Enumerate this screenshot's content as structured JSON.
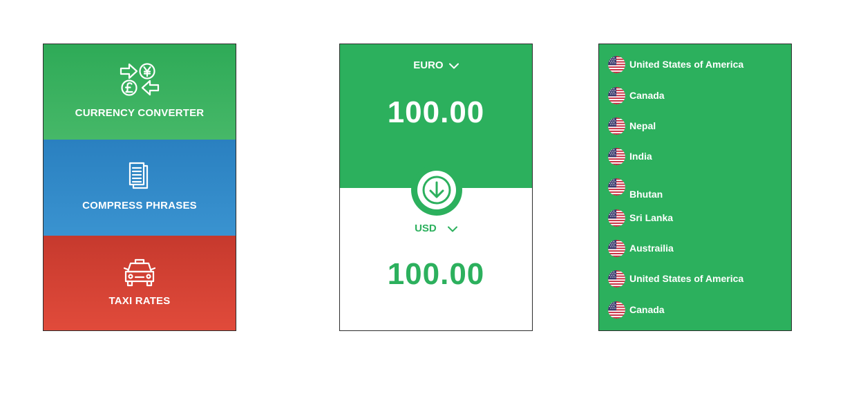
{
  "menu": {
    "items": [
      {
        "label": "CURRENCY CONVERTER",
        "icon": "currency-exchange-icon",
        "color": "#2eaa57"
      },
      {
        "label": "COMPRESS PHRASES",
        "icon": "document-icon",
        "color": "#2a80c0"
      },
      {
        "label": "TAXI RATES",
        "icon": "taxi-icon",
        "color": "#d44233"
      }
    ]
  },
  "converter": {
    "from_currency": "EURO",
    "from_amount": "100.00",
    "to_currency": "USD",
    "to_amount": "100.00",
    "accent": "#2cb05d"
  },
  "countries": [
    {
      "name": "United States of America",
      "flag": "us-flag-icon"
    },
    {
      "name": "Canada",
      "flag": "us-flag-icon"
    },
    {
      "name": "Nepal",
      "flag": "us-flag-icon"
    },
    {
      "name": "India",
      "flag": "us-flag-icon"
    },
    {
      "name": "Bhutan",
      "flag": "us-flag-icon"
    },
    {
      "name": "Sri Lanka",
      "flag": "us-flag-icon"
    },
    {
      "name": "Austrailia",
      "flag": "us-flag-icon"
    },
    {
      "name": "United States of America",
      "flag": "us-flag-icon"
    },
    {
      "name": "Canada",
      "flag": "us-flag-icon"
    }
  ]
}
